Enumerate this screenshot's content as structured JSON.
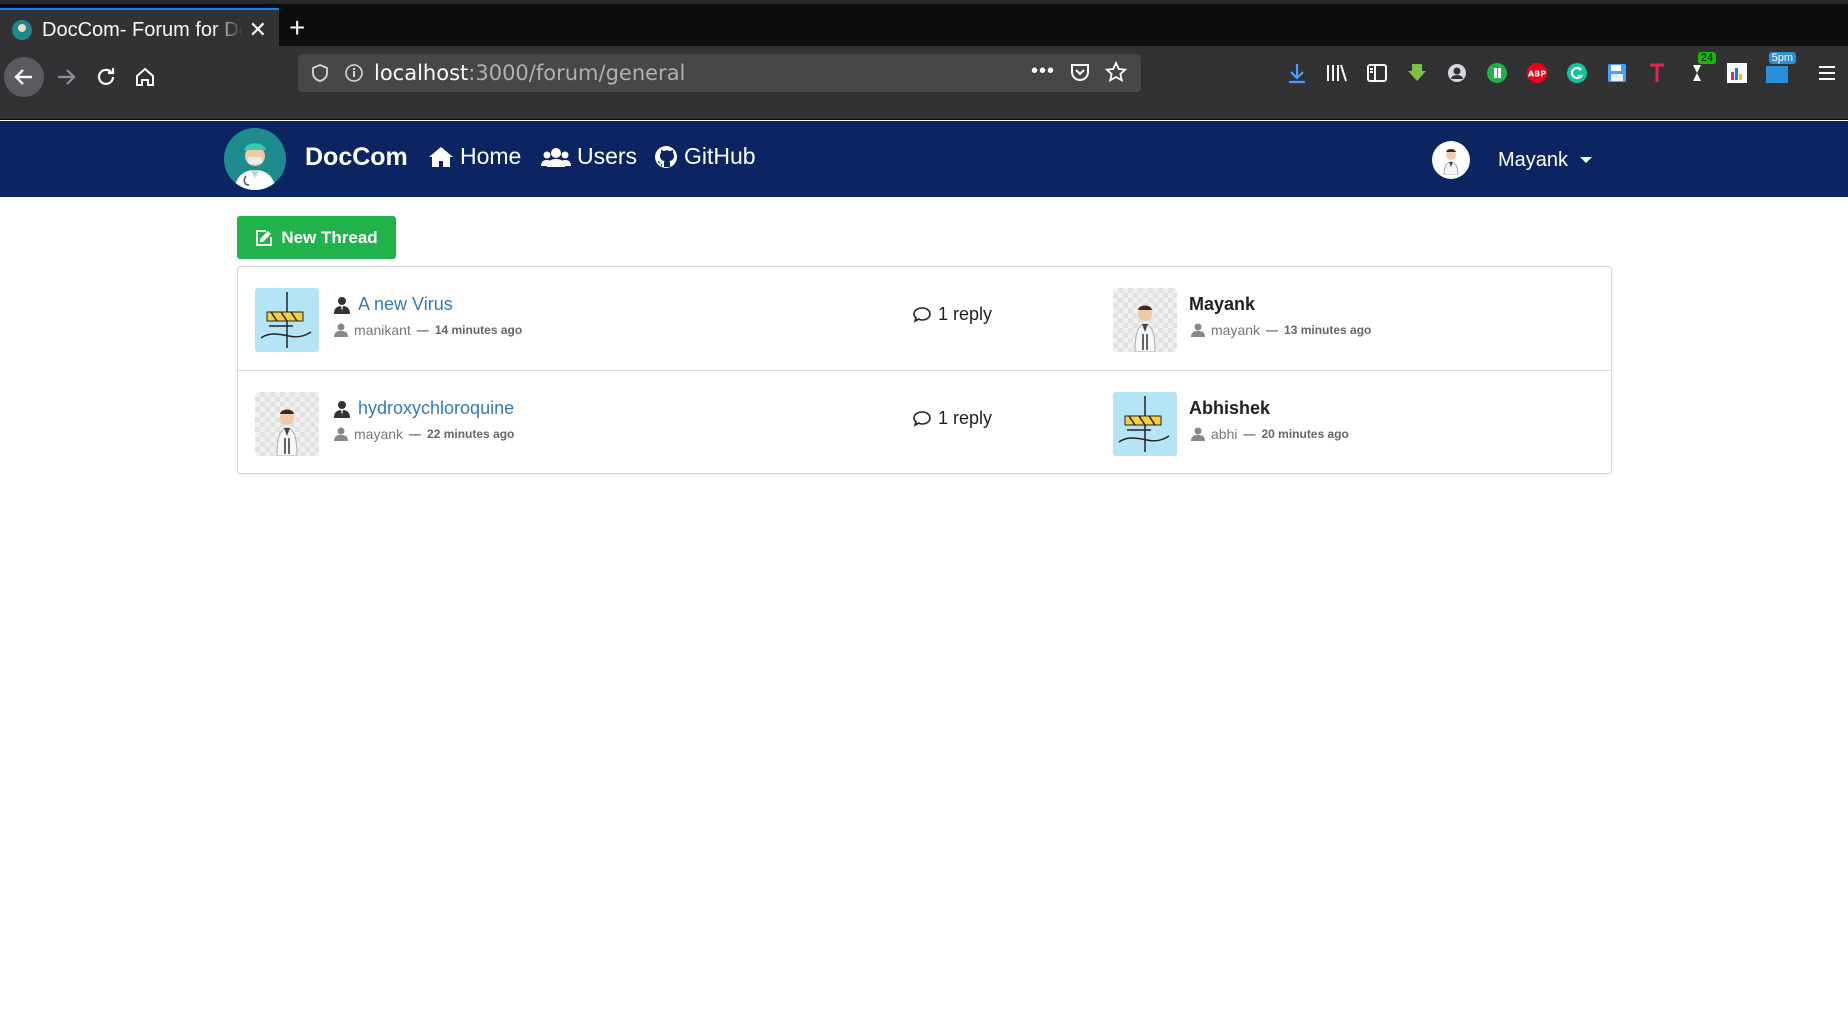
{
  "browser": {
    "tab_title": "DocCom- Forum for Doctors",
    "url_host": "localhost",
    "url_path": ":3000/forum/general",
    "badge_count": "24",
    "badge_time": "5pm"
  },
  "site": {
    "brand": "DocCom",
    "nav": {
      "home": "Home",
      "users": "Users",
      "github": "GitHub"
    },
    "user": "Mayank"
  },
  "actions": {
    "new_thread": "New Thread"
  },
  "threads": [
    {
      "title": "A new Virus",
      "author": "manikant",
      "created": "14 minutes ago",
      "replies": "1 reply",
      "last_name": "Mayank",
      "last_user": "mayank",
      "last_time": "13 minutes ago",
      "separator": "—"
    },
    {
      "title": "hydroxychloroquine",
      "author": "mayank",
      "created": "22 minutes ago",
      "replies": "1 reply",
      "last_name": "Abhishek",
      "last_user": "abhi",
      "last_time": "20 minutes ago",
      "separator": "—"
    }
  ],
  "colors": {
    "accent": "#0a84ff",
    "site_nav": "#0c2461",
    "button": "#22b24c",
    "link": "#337ab7"
  }
}
